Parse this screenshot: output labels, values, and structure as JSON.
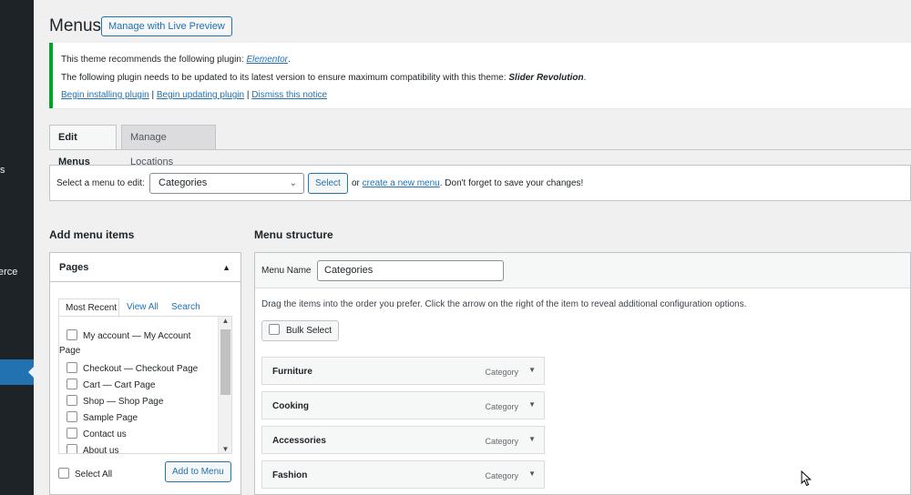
{
  "sidebar": {
    "partial_items": [
      "s",
      "erce"
    ]
  },
  "header": {
    "title": "Menus",
    "live_preview_label": "Manage with Live Preview"
  },
  "notice": {
    "line1_prefix": "This theme recommends the following plugin: ",
    "line1_plugin": "Elementor",
    "line1_suffix": ".",
    "line2_prefix": "The following plugin needs to be updated to its latest version to ensure maximum compatibility with this theme: ",
    "line2_plugin": "Slider Revolution",
    "line2_suffix": ".",
    "link_install": "Begin installing plugin",
    "link_update": "Begin updating plugin",
    "link_dismiss": "Dismiss this notice",
    "separator": " | "
  },
  "tabs": {
    "edit_menus": "Edit Menus",
    "manage_locations": "Manage Locations"
  },
  "select_bar": {
    "label": "Select a menu to edit:",
    "selected": "Categories",
    "select_button": "Select",
    "or_text": "or ",
    "create_link": "create a new menu",
    "after_text": ". Don't forget to save your changes!"
  },
  "add_menu_items": {
    "heading": "Add menu items",
    "pages_heading": "Pages",
    "tabs": {
      "recent": "Most Recent",
      "view_all": "View All",
      "search": "Search"
    },
    "items": [
      {
        "label": "My account",
        "state": " — My Account",
        "wrap": "Page"
      },
      {
        "label": "Checkout",
        "state": " — Checkout Page"
      },
      {
        "label": "Cart",
        "state": " — Cart Page"
      },
      {
        "label": "Shop",
        "state": " — Shop Page"
      },
      {
        "label": "Sample Page",
        "state": ""
      },
      {
        "label": "Contact us",
        "state": ""
      },
      {
        "label": "About us",
        "state": ""
      }
    ],
    "select_all": "Select All",
    "add_button": "Add to Menu"
  },
  "menu_structure": {
    "heading": "Menu structure",
    "menu_name_label": "Menu Name",
    "menu_name_value": "Categories",
    "drag_hint": "Drag the items into the order you prefer. Click the arrow on the right of the item to reveal additional configuration options.",
    "bulk_select": "Bulk Select",
    "items": [
      {
        "title": "Furniture",
        "type": "Category"
      },
      {
        "title": "Cooking",
        "type": "Category"
      },
      {
        "title": "Accessories",
        "type": "Category"
      },
      {
        "title": "Fashion",
        "type": "Category"
      }
    ]
  },
  "icons": {
    "collapse": "▲",
    "chevron": "⌄",
    "expand": "▼"
  },
  "colors": {
    "sidebar_bg": "#1d2327",
    "accent": "#2271b1",
    "notice_border": "#00a32a"
  }
}
